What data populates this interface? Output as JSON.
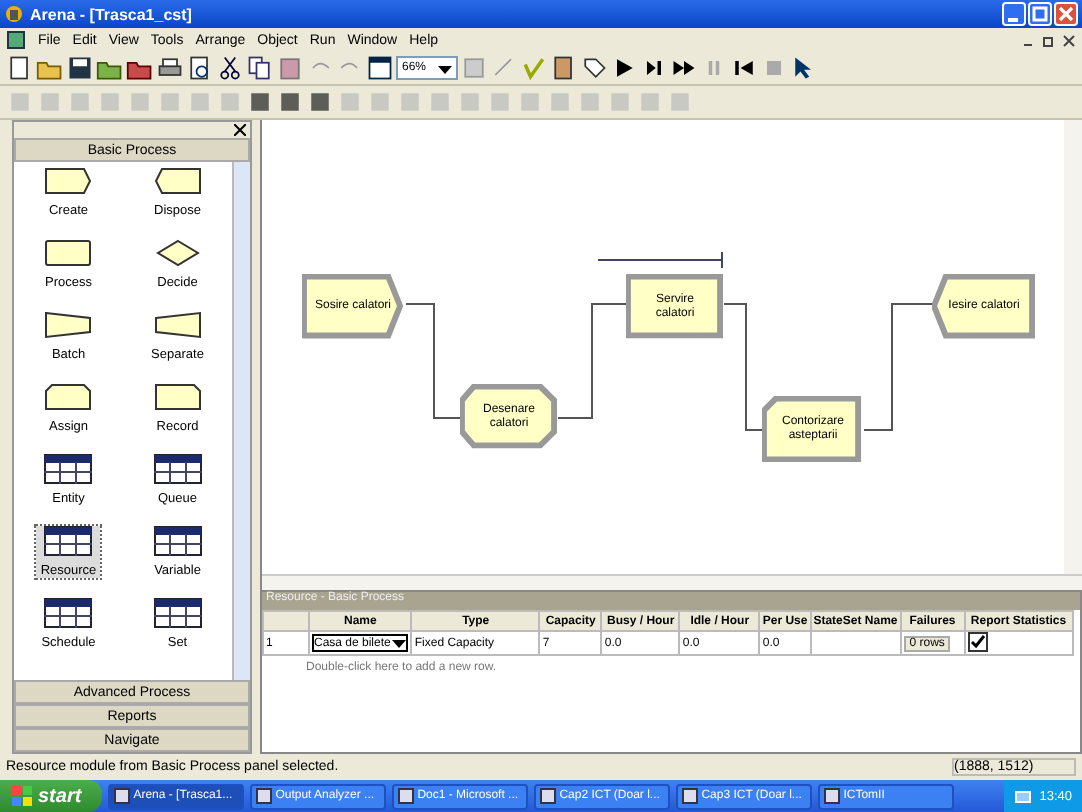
{
  "window": {
    "title": "Arena - [Trasca1_cst]"
  },
  "menu": [
    "File",
    "Edit",
    "View",
    "Tools",
    "Arrange",
    "Object",
    "Run",
    "Window",
    "Help"
  ],
  "zoom": {
    "value": "66%"
  },
  "panel": {
    "title": "Basic Process",
    "modules": [
      {
        "label": "Create",
        "kind": "create",
        "selected": false
      },
      {
        "label": "Dispose",
        "kind": "dispose",
        "selected": false
      },
      {
        "label": "Process",
        "kind": "process",
        "selected": false
      },
      {
        "label": "Decide",
        "kind": "decide",
        "selected": false
      },
      {
        "label": "Batch",
        "kind": "batch",
        "selected": false
      },
      {
        "label": "Separate",
        "kind": "separate",
        "selected": false
      },
      {
        "label": "Assign",
        "kind": "assign",
        "selected": false
      },
      {
        "label": "Record",
        "kind": "record",
        "selected": false
      },
      {
        "label": "Entity",
        "kind": "data",
        "selected": false
      },
      {
        "label": "Queue",
        "kind": "data",
        "selected": false
      },
      {
        "label": "Resource",
        "kind": "data",
        "selected": true
      },
      {
        "label": "Variable",
        "kind": "data",
        "selected": false
      },
      {
        "label": "Schedule",
        "kind": "data",
        "selected": false
      },
      {
        "label": "Set",
        "kind": "data",
        "selected": false
      }
    ],
    "sections": [
      "Advanced Process",
      "Reports",
      "Navigate"
    ]
  },
  "flowchart": {
    "nodes": [
      {
        "label": "Sosire calatori",
        "kind": "create"
      },
      {
        "label": "Desenare calatori",
        "kind": "assign"
      },
      {
        "label": "Servire calatori",
        "kind": "process"
      },
      {
        "label": "Contorizare asteptarii",
        "kind": "record"
      },
      {
        "label": "Iesire calatori",
        "kind": "dispose"
      }
    ]
  },
  "spreadsheet": {
    "title": "Resource - Basic Process",
    "columns": [
      "Name",
      "Type",
      "Capacity",
      "Busy / Hour",
      "Idle / Hour",
      "Per Use",
      "StateSet Name",
      "Failures",
      "Report Statistics"
    ],
    "rows": [
      {
        "number": "1",
        "name": "Casa de bilete",
        "type": "Fixed Capacity",
        "capacity": "7",
        "busy_hour": "0.0",
        "idle_hour": "0.0",
        "per_use": "0.0",
        "failures": "0 rows",
        "report_statistics": true
      }
    ],
    "add_row_hint": "Double-click here to add a new row."
  },
  "status_bar": {
    "message": "Resource module from Basic Process panel selected.",
    "coordinates": "(1888, 1512)"
  },
  "taskbar": {
    "start": "start",
    "tasks": [
      {
        "label": "Arena - [Trasca1...",
        "selected": true
      },
      {
        "label": "Output Analyzer ...",
        "selected": false
      },
      {
        "label": "Doc1 - Microsoft ...",
        "selected": false
      },
      {
        "label": "Cap2 ICT (Doar l...",
        "selected": false
      },
      {
        "label": "Cap3 ICT (Doar l...",
        "selected": false
      },
      {
        "label": "ICTomII",
        "selected": false
      }
    ],
    "clock": "13:40"
  }
}
